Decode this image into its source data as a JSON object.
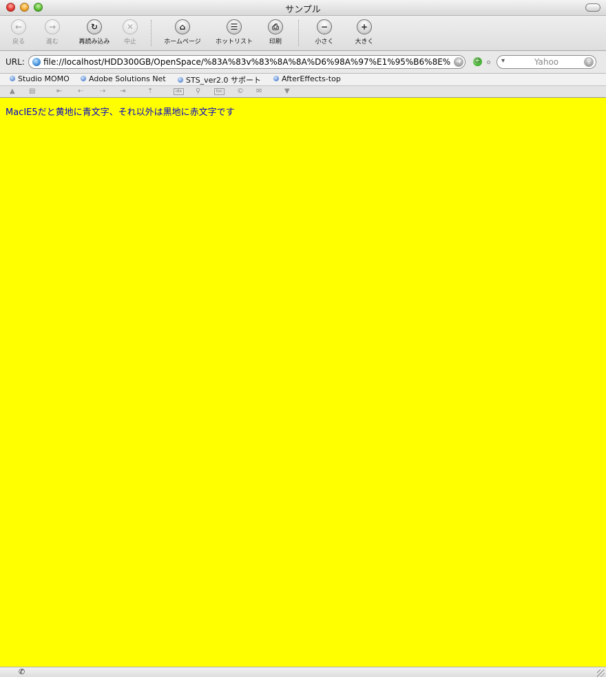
{
  "window": {
    "title": "サンプル"
  },
  "toolbar": {
    "buttons": [
      {
        "label": "戻る",
        "icon": "←",
        "enabled": false
      },
      {
        "label": "進む",
        "icon": "→",
        "enabled": false
      },
      {
        "label": "再読み込み",
        "icon": "↻",
        "enabled": true
      },
      {
        "label": "中止",
        "icon": "✕",
        "enabled": false
      },
      {
        "label": "ホームページ",
        "icon": "⌂",
        "enabled": true
      },
      {
        "label": "ホットリスト",
        "icon": "☰",
        "enabled": true
      },
      {
        "label": "印刷",
        "icon": "⎙",
        "enabled": true
      },
      {
        "label": "小さく",
        "icon": "−",
        "enabled": true
      },
      {
        "label": "大きく",
        "icon": "+",
        "enabled": true
      }
    ]
  },
  "address": {
    "label": "URL:",
    "value": "file://localhost/HDD300GB/OpenSpace/%83A%83v%83%8A%8A%D6%98A%97%E1%95%B6%8E%",
    "go_icon": "➜"
  },
  "search": {
    "placeholder": "Yahoo",
    "dropdown_icon": "▾",
    "search_icon": "⚲"
  },
  "favorites": [
    {
      "label": "Studio MOMO"
    },
    {
      "label": "Adobe Solutions Net"
    },
    {
      "label": "STS_ver2.0 サポート"
    },
    {
      "label": "AfterEffects-top"
    }
  ],
  "icon_strip": {
    "home": "▲",
    "list": "▤",
    "first": "⇤",
    "prev": "⇠",
    "next": "⇢",
    "last": "⇥",
    "up": "⇡",
    "index": "idx",
    "find": "⚲",
    "toc": "toc",
    "copyright": "©",
    "mail": "✉",
    "more": "▼"
  },
  "content": {
    "text": "MacIE5だと黄地に青文字、それ以外は黒地に赤文字です",
    "background": "#ffff00",
    "text_color": "#0000cc"
  },
  "status": {
    "phone_icon": "✆"
  }
}
